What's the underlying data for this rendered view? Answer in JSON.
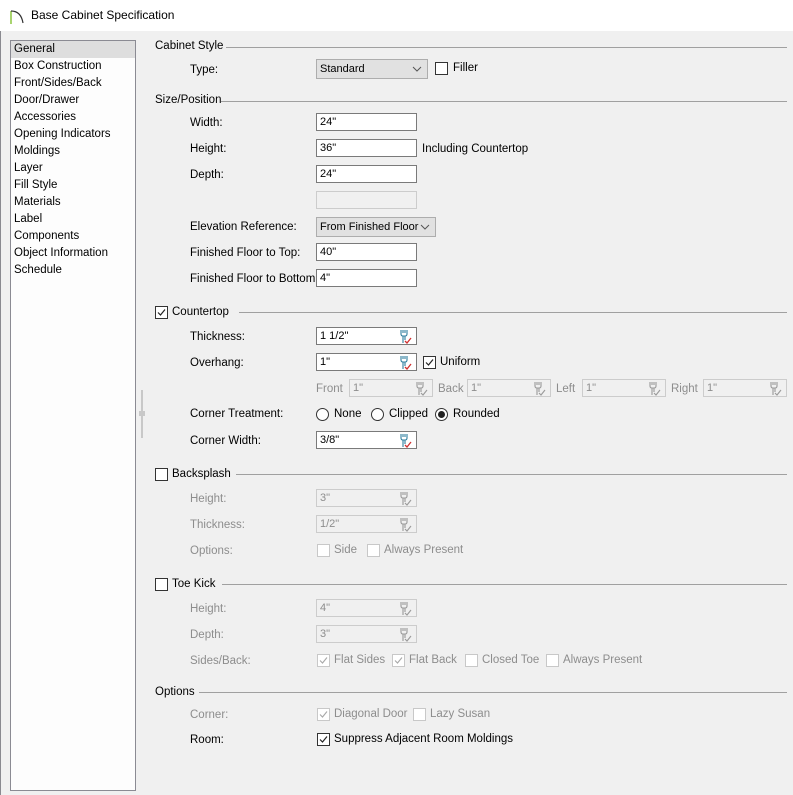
{
  "window": {
    "title": "Base Cabinet Specification",
    "icon": "arc-icon"
  },
  "nav": {
    "selected": 0,
    "items": [
      {
        "label": "General"
      },
      {
        "label": "Box Construction"
      },
      {
        "label": "Front/Sides/Back"
      },
      {
        "label": "Door/Drawer"
      },
      {
        "label": "Accessories"
      },
      {
        "label": "Opening Indicators"
      },
      {
        "label": "Moldings"
      },
      {
        "label": "Layer"
      },
      {
        "label": "Fill Style"
      },
      {
        "label": "Materials"
      },
      {
        "label": "Label"
      },
      {
        "label": "Components"
      },
      {
        "label": "Object Information"
      },
      {
        "label": "Schedule"
      }
    ]
  },
  "cabinet_style": {
    "title": "Cabinet Style",
    "type_label": "Type:",
    "type_value": "Standard",
    "filler_label": "Filler",
    "filler_checked": false
  },
  "size_position": {
    "title": "Size/Position",
    "width_label": "Width:",
    "width_value": "24\"",
    "height_label": "Height:",
    "height_value": "36\"",
    "height_note": "Including Countertop",
    "depth_label": "Depth:",
    "depth_value": "24\"",
    "blank_value": "",
    "elevation_label": "Elevation Reference:",
    "elevation_value": "From Finished Floor",
    "ff_top_label": "Finished Floor to Top:",
    "ff_top_value": "40\"",
    "ff_bottom_label": "Finished Floor to Bottom:",
    "ff_bottom_value": "4\""
  },
  "countertop": {
    "title": "Countertop",
    "checked": true,
    "thickness_label": "Thickness:",
    "thickness_value": "1 1/2\"",
    "overhang_label": "Overhang:",
    "overhang_value": "1\"",
    "uniform_label": "Uniform",
    "uniform_checked": true,
    "front_label": "Front",
    "front_value": "1\"",
    "back_label": "Back",
    "back_value": "1\"",
    "left_label": "Left",
    "left_value": "1\"",
    "right_label": "Right",
    "right_value": "1\"",
    "corner_treatment_label": "Corner Treatment:",
    "corner_options": [
      "None",
      "Clipped",
      "Rounded"
    ],
    "corner_selected": "Rounded",
    "corner_width_label": "Corner Width:",
    "corner_width_value": "3/8\""
  },
  "backsplash": {
    "title": "Backsplash",
    "checked": false,
    "height_label": "Height:",
    "height_value": "3\"",
    "thickness_label": "Thickness:",
    "thickness_value": "1/2\"",
    "options_label": "Options:",
    "side_label": "Side",
    "side_checked": false,
    "always_label": "Always Present",
    "always_checked": false
  },
  "toe_kick": {
    "title": "Toe Kick",
    "checked": false,
    "height_label": "Height:",
    "height_value": "4\"",
    "depth_label": "Depth:",
    "depth_value": "3\"",
    "sides_label": "Sides/Back:",
    "flat_sides_label": "Flat Sides",
    "flat_sides_checked": true,
    "flat_back_label": "Flat Back",
    "flat_back_checked": true,
    "closed_toe_label": "Closed Toe",
    "closed_toe_checked": false,
    "always_label": "Always Present",
    "always_checked": false
  },
  "options": {
    "title": "Options",
    "corner_label": "Corner:",
    "diagonal_label": "Diagonal Door",
    "diagonal_checked": true,
    "lazy_label": "Lazy Susan",
    "lazy_checked": false,
    "room_label": "Room:",
    "suppress_label": "Suppress Adjacent Room Moldings",
    "suppress_checked": true
  },
  "colors": {
    "wrench_blue": "#2f7f9f",
    "check_red": "#d03030",
    "disabled_text": "#8d8d8d"
  }
}
